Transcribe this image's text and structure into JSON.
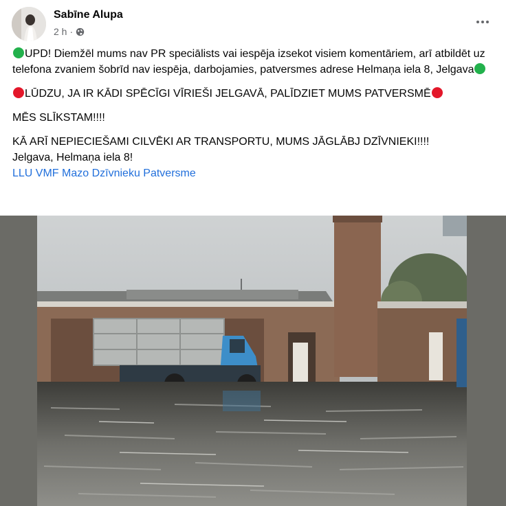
{
  "post": {
    "author": "Sabīne Alupa",
    "time": "2 h",
    "more_icon": "more-horizontal-icon",
    "audience_icon": "globe-icon"
  },
  "content": {
    "p1": "UPD! Diemžēl mums nav PR speciālists vai iespēja izsekot visiem komentāriem, arī atbildēt uz telefona zvaniem šobrīd nav iespēja, darbojamies, patversmes adrese Helmaņa iela 8, Jelgava",
    "p2": "LŪDZU, JA IR KĀDI SPĒCĪGI VĪRIEŠI JELGAVĀ, PALĪDZIET MUMS PATVERSMĒ",
    "p3": "MĒS SLĪKSTAM!!!!",
    "p4_line1": "KĀ ARĪ NEPIECIEŠAMI CILVĒKI AR TRANSPORTU, MUMS JĀGLĀBJ DZĪVNIEKI!!!!",
    "p4_line2": "Jelgava, Helmaņa iela 8!",
    "link": "LLU VMF Mazo Dzīvnieku Patversme"
  },
  "colors": {
    "green_dot": "#22b14c",
    "red_dot": "#e3172a",
    "link": "#216fdb"
  }
}
